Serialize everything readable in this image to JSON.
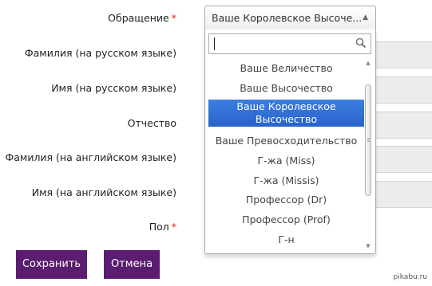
{
  "form": {
    "fields": [
      {
        "label": "Обращение",
        "required": true
      },
      {
        "label": "Фамилия (на русском языке)",
        "required": false
      },
      {
        "label": "Имя (на русском языке)",
        "required": false
      },
      {
        "label": "Отчество",
        "required": false
      },
      {
        "label": "Фамилия (на английском языке)",
        "required": false
      },
      {
        "label": "Имя (на английском языке)",
        "required": false
      },
      {
        "label": "Пол",
        "required": true
      }
    ],
    "required_mark": "*"
  },
  "title_select": {
    "selected_value": "Ваше Королевское Высоче...",
    "arrow": "▲",
    "search_value": "",
    "options": [
      "Ваше Величество",
      "Ваше Высочество",
      "Ваше Королевское Высочество",
      "Ваше Превосходительство",
      "Г-жа (Miss)",
      "Г-жа (Missis)",
      "Профессор (Dr)",
      "Профессор (Prof)",
      "Г-н"
    ],
    "highlighted_option": "Ваше Королевское Высочество"
  },
  "buttons": {
    "save_label": "Сохранить",
    "cancel_label": "Отмена"
  },
  "watermark": "pikabu.ru",
  "colors": {
    "button_bg": "#5b1d6f",
    "highlight": "#3875d7",
    "required": "#d9221b"
  },
  "icons": {
    "search": "search-icon",
    "dropdown_arrow": "chevron-up-icon",
    "scroll_up": "scroll-up-arrow-icon",
    "scroll_down": "scroll-down-arrow-icon"
  }
}
